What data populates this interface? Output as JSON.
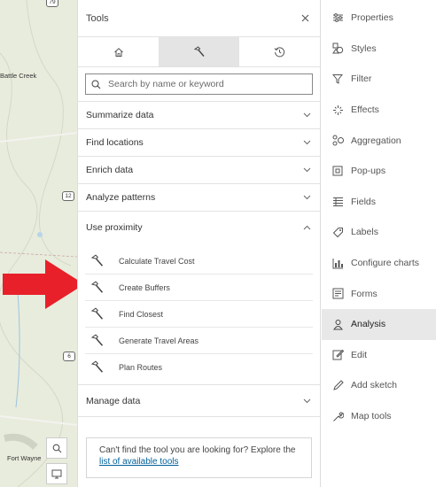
{
  "map": {
    "cities": [
      "Battle Creek",
      "Fort Wayne"
    ],
    "shields": [
      "79",
      "12",
      "6"
    ]
  },
  "tools_panel": {
    "title": "Tools",
    "tabs": [
      {
        "icon": "home-icon",
        "active": false
      },
      {
        "icon": "hammer-icon",
        "active": true
      },
      {
        "icon": "history-icon",
        "active": false
      }
    ],
    "search": {
      "placeholder": "Search by name or keyword",
      "value": ""
    },
    "categories": [
      {
        "label": "Summarize data",
        "expanded": false
      },
      {
        "label": "Find locations",
        "expanded": false
      },
      {
        "label": "Enrich data",
        "expanded": false
      },
      {
        "label": "Analyze patterns",
        "expanded": false
      }
    ],
    "proximity": {
      "label": "Use proximity",
      "expanded": true,
      "tools": [
        "Calculate Travel Cost",
        "Create Buffers",
        "Find Closest",
        "Generate Travel Areas",
        "Plan Routes"
      ]
    },
    "manage": {
      "label": "Manage data",
      "expanded": false
    },
    "notice": {
      "text": "Can't find the tool you are looking for? Explore the ",
      "link": "list of available tools"
    }
  },
  "sidebar": {
    "items": [
      {
        "label": "Properties",
        "icon": "properties-icon",
        "active": false
      },
      {
        "label": "Styles",
        "icon": "styles-icon",
        "active": false
      },
      {
        "label": "Filter",
        "icon": "filter-icon",
        "active": false
      },
      {
        "label": "Effects",
        "icon": "effects-icon",
        "active": false
      },
      {
        "label": "Aggregation",
        "icon": "aggregation-icon",
        "active": false
      },
      {
        "label": "Pop-ups",
        "icon": "popups-icon",
        "active": false
      },
      {
        "label": "Fields",
        "icon": "fields-icon",
        "active": false
      },
      {
        "label": "Labels",
        "icon": "labels-icon",
        "active": false
      },
      {
        "label": "Configure charts",
        "icon": "charts-icon",
        "active": false
      },
      {
        "label": "Forms",
        "icon": "forms-icon",
        "active": false
      },
      {
        "label": "Analysis",
        "icon": "analysis-icon",
        "active": true
      },
      {
        "label": "Edit",
        "icon": "edit-icon",
        "active": false
      },
      {
        "label": "Add sketch",
        "icon": "sketch-icon",
        "active": false
      },
      {
        "label": "Map tools",
        "icon": "map-tools-icon",
        "active": false
      }
    ]
  },
  "colors": {
    "accent": "#e8e8e8",
    "arrow": "#e8202a",
    "link": "#00619b"
  }
}
